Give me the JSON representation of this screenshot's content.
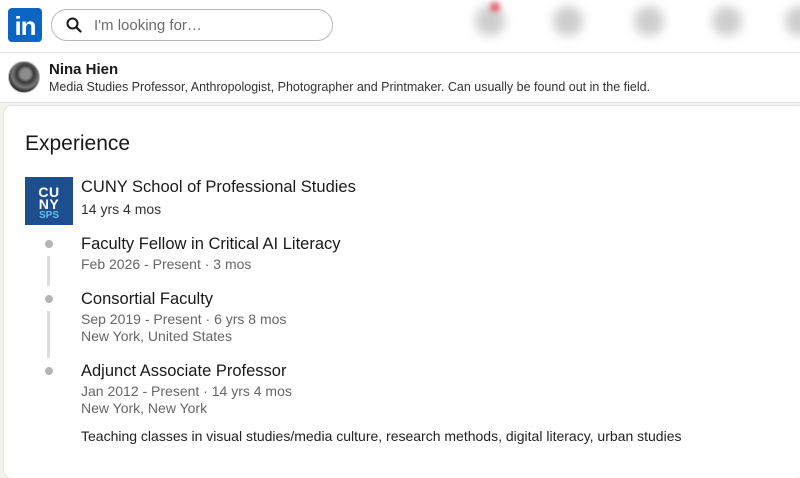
{
  "nav": {
    "logo_text": "in",
    "search_placeholder": "I'm looking for…"
  },
  "profile": {
    "name": "Nina Hien",
    "headline": "Media Studies Professor, Anthropologist, Photographer and Printmaker. Can usually be found out in the field."
  },
  "experience": {
    "title": "Experience",
    "company": {
      "name": "CUNY School of Professional Studies",
      "duration": "14 yrs 4 mos",
      "logo_lines": [
        "CU",
        "NY",
        "SPS"
      ]
    },
    "roles": [
      {
        "title": "Faculty Fellow in Critical AI Literacy",
        "dates": "Feb 2026 - Present · 3 mos"
      },
      {
        "title": "Consortial Faculty",
        "dates": "Sep 2019 - Present · 6 yrs 8 mos",
        "location": "New York, United States"
      },
      {
        "title": "Adjunct Associate Professor",
        "dates": "Jan 2012 - Present · 14 yrs 4 mos",
        "location": "New York, New York",
        "description": "Teaching classes in visual studies/media culture, research methods, digital literacy, urban studies"
      }
    ]
  },
  "colors": {
    "brand": "#0a66c2",
    "company_logo_bg": "#1f4e8f",
    "company_logo_accent": "#5fc0e8"
  },
  "icons": [
    "linkedin-logo",
    "search-icon"
  ]
}
